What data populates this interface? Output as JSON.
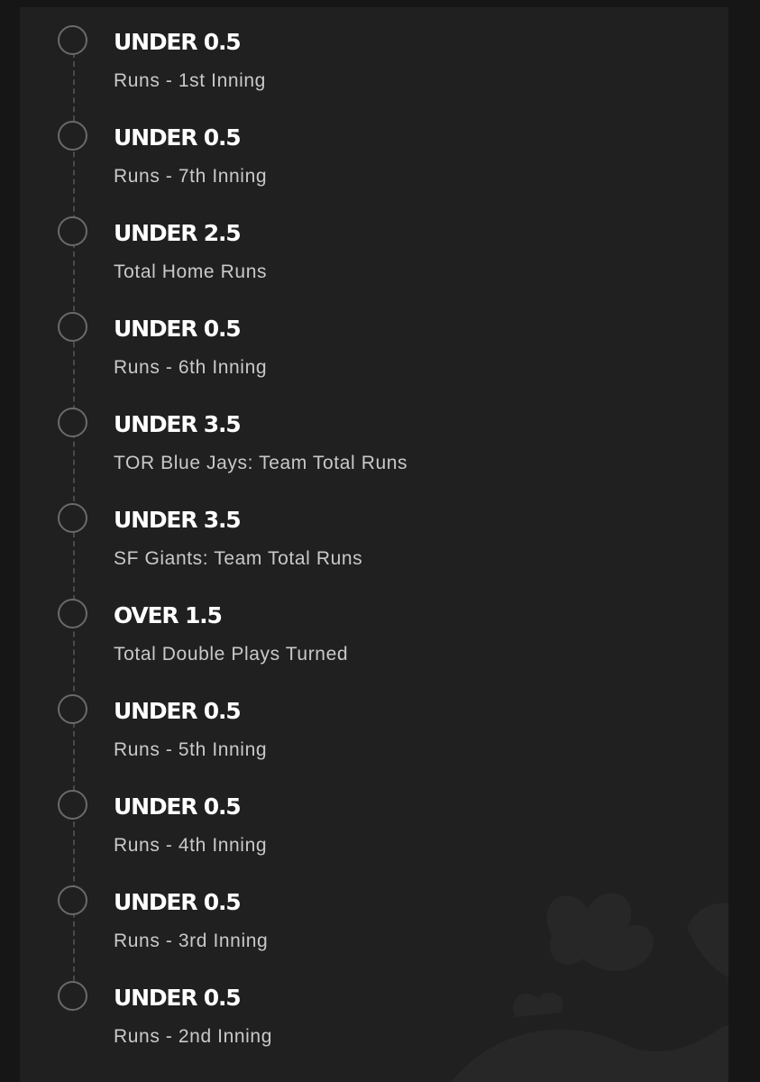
{
  "legs": [
    {
      "pick": "UNDER 0.5",
      "market": "Runs - 1st Inning"
    },
    {
      "pick": "UNDER 0.5",
      "market": "Runs - 7th Inning"
    },
    {
      "pick": "UNDER 2.5",
      "market": "Total Home Runs"
    },
    {
      "pick": "UNDER 0.5",
      "market": "Runs - 6th Inning"
    },
    {
      "pick": "UNDER 3.5",
      "market": "TOR Blue Jays: Team Total Runs"
    },
    {
      "pick": "UNDER 3.5",
      "market": "SF Giants: Team Total Runs"
    },
    {
      "pick": "OVER 1.5",
      "market": "Total Double Plays Turned"
    },
    {
      "pick": "UNDER 0.5",
      "market": "Runs - 5th Inning"
    },
    {
      "pick": "UNDER 0.5",
      "market": "Runs - 4th Inning"
    },
    {
      "pick": "UNDER 0.5",
      "market": "Runs - 3rd Inning"
    },
    {
      "pick": "UNDER 0.5",
      "market": "Runs - 2nd Inning"
    }
  ],
  "icons": {
    "leg_marker": "circle-outline-icon",
    "watermark": "crown-logo-icon"
  },
  "colors": {
    "background": "#161616",
    "panel": "#202020",
    "pick_text": "#ffffff",
    "market_text": "#c9c9c9",
    "marker_stroke": "#6a6a6a"
  }
}
